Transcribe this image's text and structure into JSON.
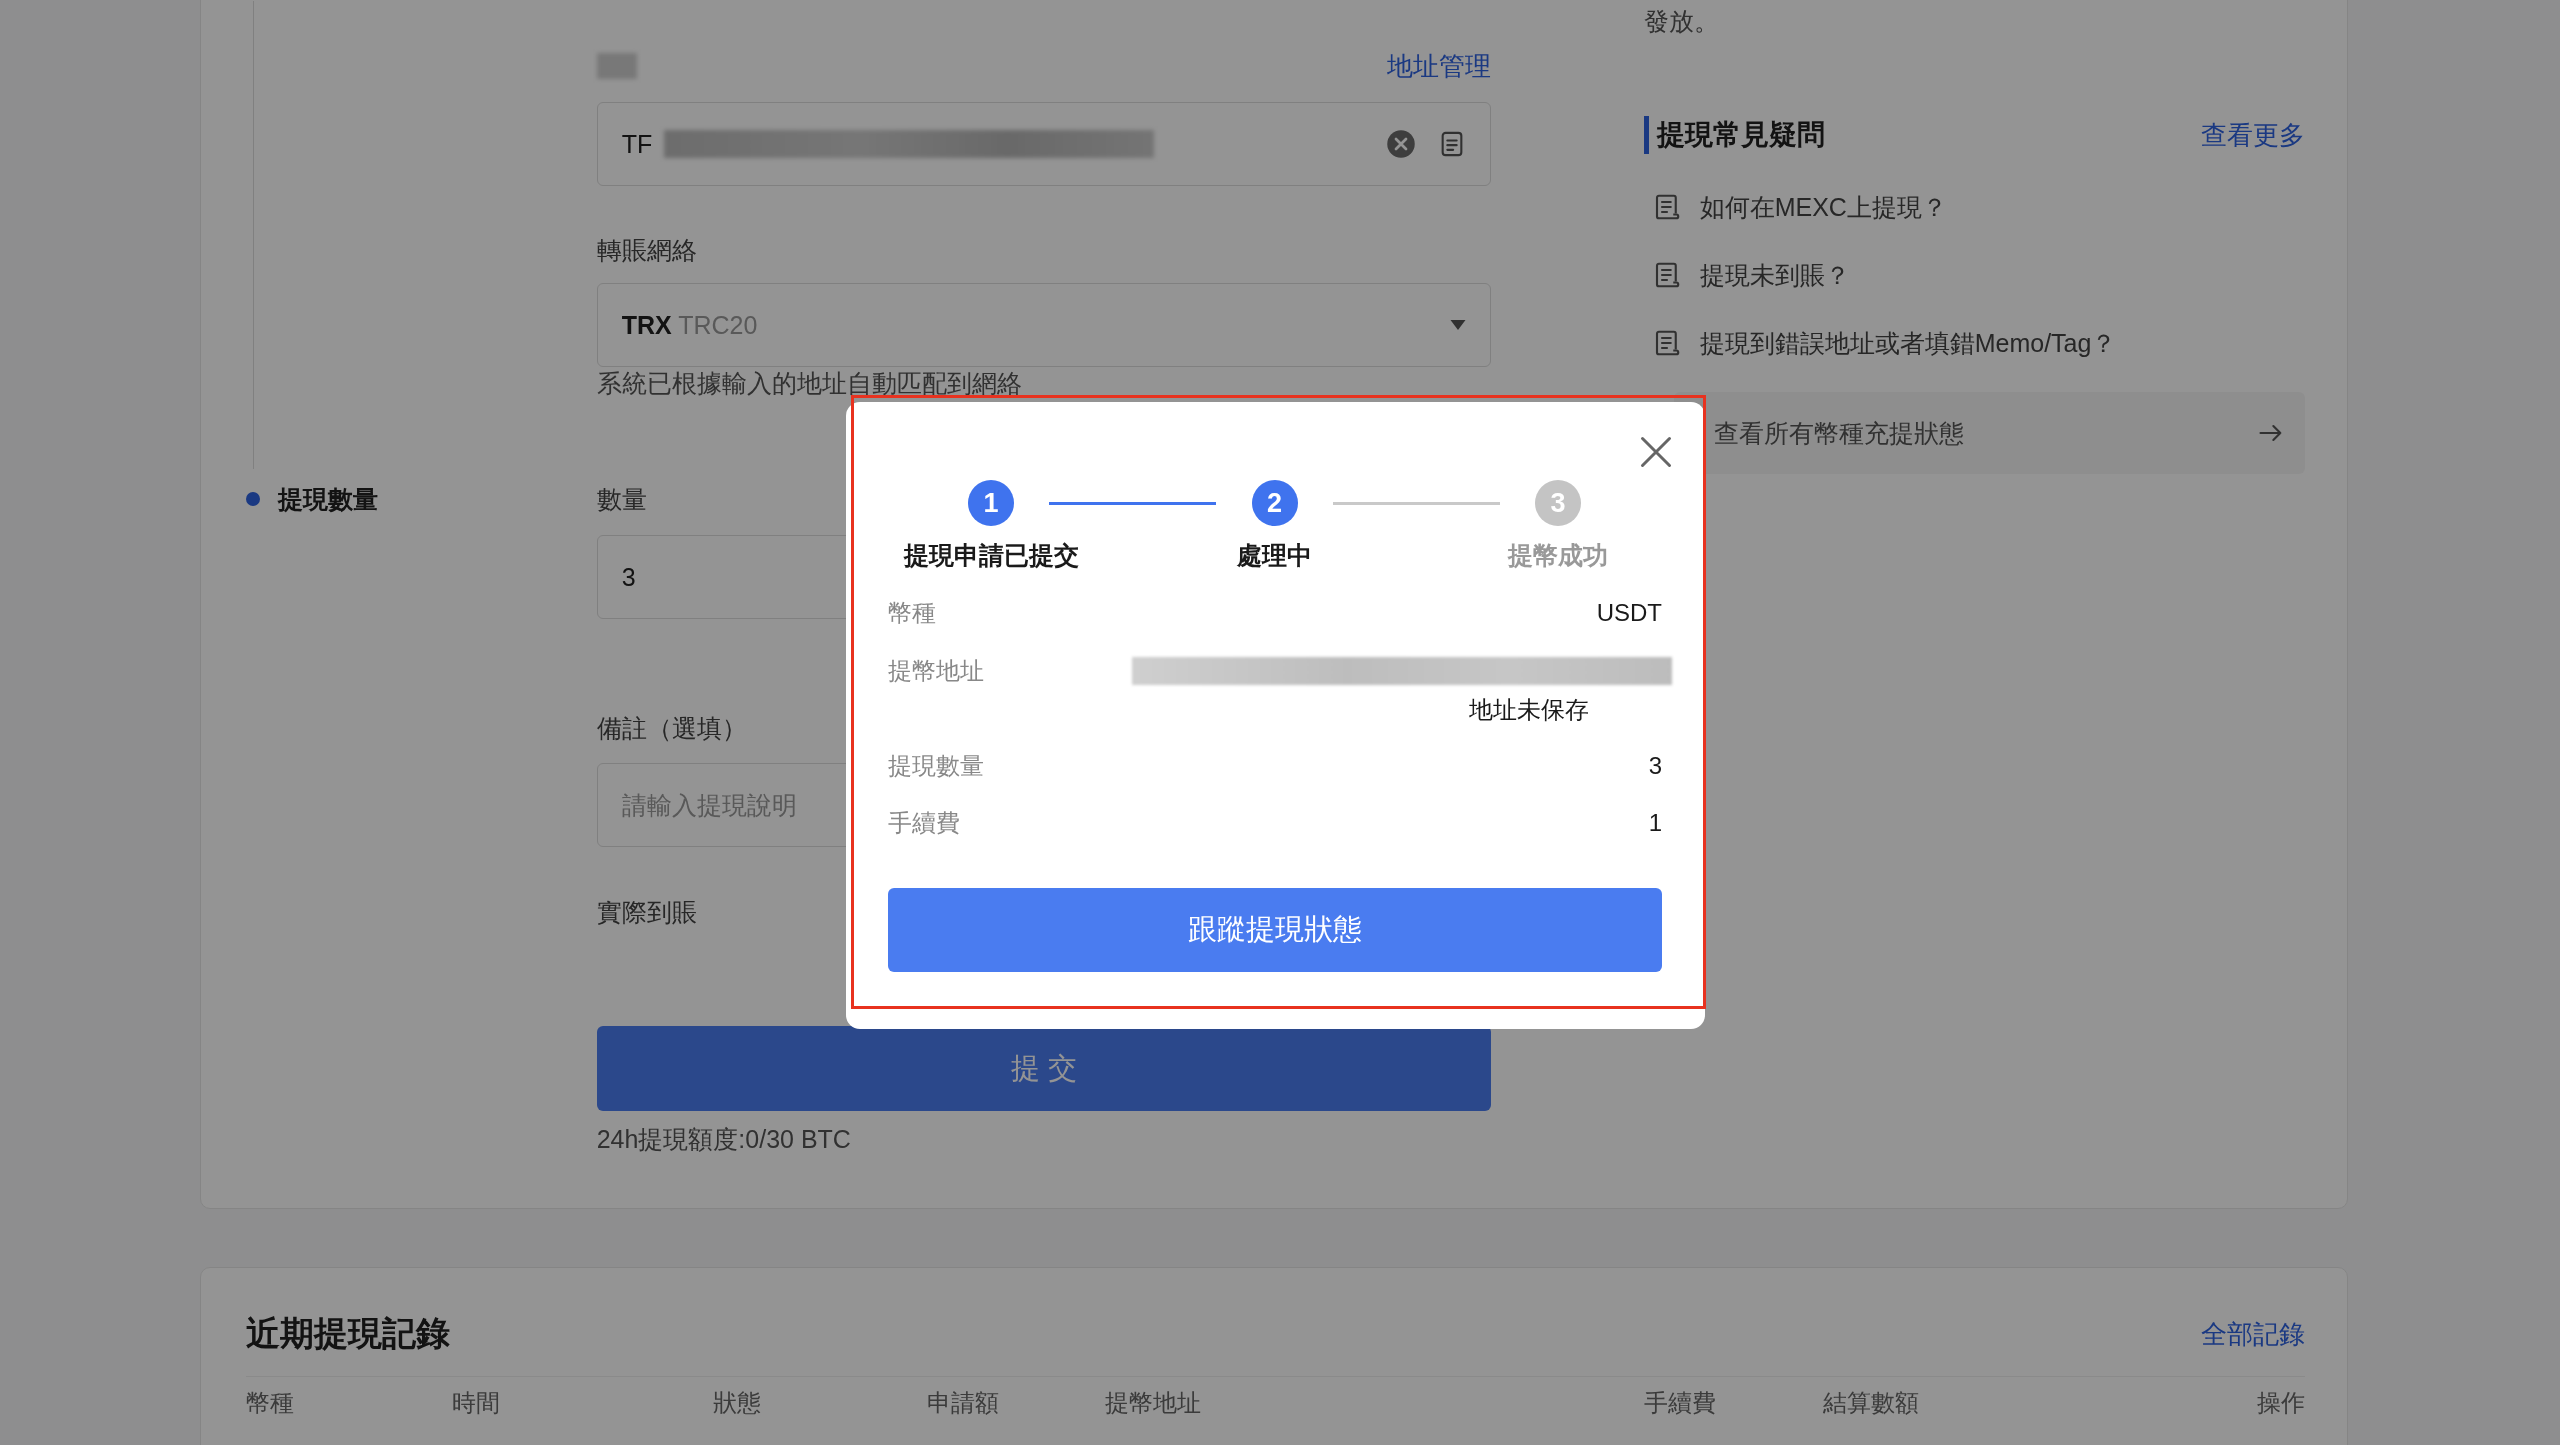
{
  "step_label": {
    "label": "提現數量",
    "active": true
  },
  "address": {
    "manage_link": "地址管理",
    "value": "TF"
  },
  "network": {
    "label": "轉賬網絡",
    "value": "TRX",
    "standard": "TRC20",
    "hint": "系統已根據輸入的地址自動匹配到網絡"
  },
  "amount": {
    "label": "數量",
    "value": "3"
  },
  "memo": {
    "label": "備註（選填）",
    "placeholder": "請輸入提現說明"
  },
  "received": {
    "label": "實際到賬"
  },
  "submit_button": "提 交",
  "limit_text": "24h提現額度:0/30 BTC",
  "notice_tail": "發放。",
  "faq": {
    "title": "提現常見疑問",
    "more_link": "查看更多",
    "items": [
      "如何在MEXC上提現？",
      "提現未到賬？",
      "提現到錯誤地址或者填錯Memo/Tag？"
    ],
    "status_link": "查看所有幣種充提狀態"
  },
  "records": {
    "title": "近期提現記錄",
    "all_link": "全部記錄",
    "columns": [
      "幣種",
      "時間",
      "狀態",
      "申請額",
      "提幣地址",
      "手續費",
      "結算數額",
      "操作"
    ]
  },
  "modal": {
    "steps": [
      {
        "number": "1",
        "label": "提現申請已提交",
        "reached": true
      },
      {
        "number": "2",
        "label": "處理中",
        "reached": true
      },
      {
        "number": "3",
        "label": "提幣成功",
        "reached": false
      }
    ],
    "details": [
      {
        "kind": "text",
        "label": "幣種",
        "value": "USDT"
      },
      {
        "kind": "address",
        "label": "提幣地址",
        "note": "地址未保存"
      },
      {
        "kind": "text",
        "label": "提現數量",
        "value": "3"
      },
      {
        "kind": "text",
        "label": "手續費",
        "value": "1"
      }
    ],
    "button": "跟蹤提現狀態"
  }
}
